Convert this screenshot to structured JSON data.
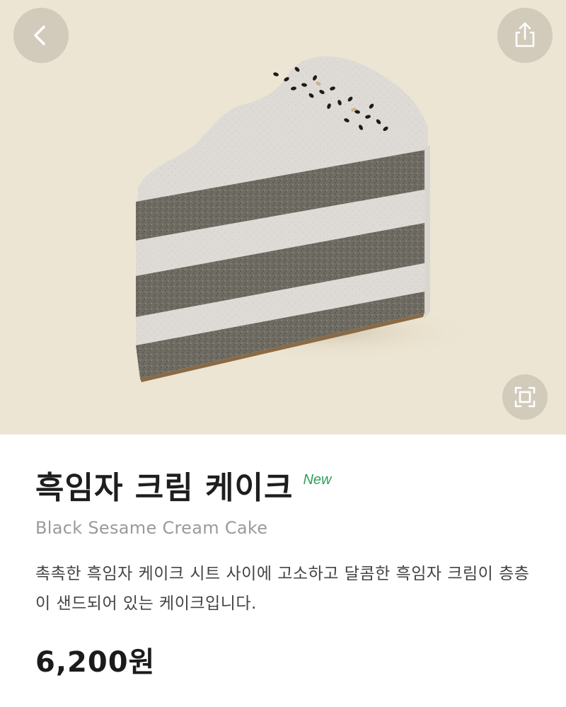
{
  "header": {
    "back_icon": "chevron-left-icon",
    "share_icon": "share-icon",
    "zoom_icon": "expand-icon"
  },
  "product": {
    "name": "흑임자 크림 케이크",
    "badge": "New",
    "english_name": "Black Sesame Cream Cake",
    "description": "촉촉한 흑임자 케이크 시트 사이에 고소하고 달콤한 흑임자 크림이 층층이 샌드되어 있는 케이크입니다.",
    "price": "6,200원"
  },
  "colors": {
    "hero_background": "#ede5d3",
    "badge_green": "#2e9e5b",
    "title_text": "#1e1e1e",
    "subtitle_text": "#9a9a9a"
  }
}
